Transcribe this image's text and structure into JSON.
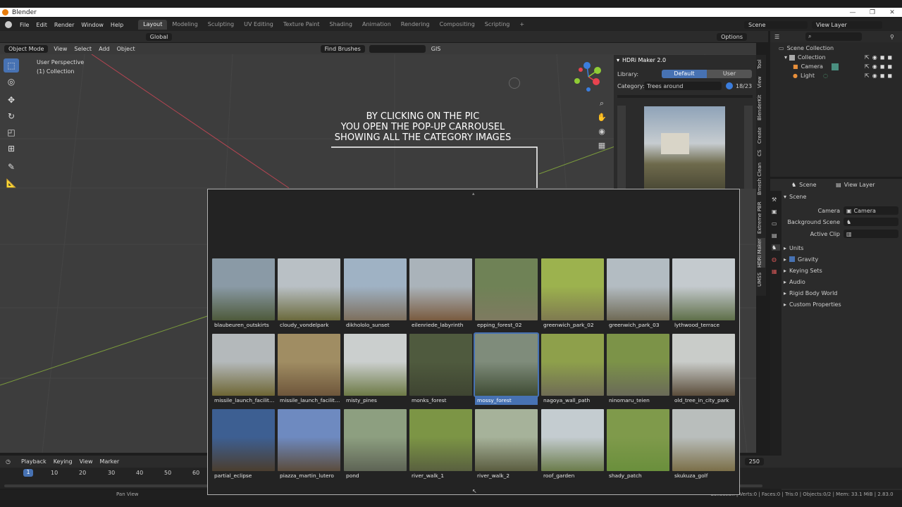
{
  "app": {
    "title": "Blender",
    "window_controls": [
      "—",
      "❐",
      "✕"
    ]
  },
  "menu": [
    "File",
    "Edit",
    "Render",
    "Window",
    "Help"
  ],
  "workspaces": {
    "tabs": [
      "Layout",
      "Modeling",
      "Sculpting",
      "UV Editing",
      "Texture Paint",
      "Shading",
      "Animation",
      "Rendering",
      "Compositing",
      "Scripting"
    ],
    "active": "Layout",
    "add": "+"
  },
  "scene_field": "Scene",
  "view_layer_field": "View Layer",
  "viewport_header": {
    "mode": "Object Mode",
    "menus": [
      "View",
      "Select",
      "Add",
      "Object"
    ],
    "orientation": "Global",
    "find_brushes": "Find Brushes",
    "gis": "GIS",
    "options": "Options"
  },
  "viewport": {
    "perspective": "User Perspective",
    "collection": "(1) Collection",
    "instruction": [
      "BY CLICKING ON THE PIC",
      "YOU OPEN THE POP-UP CARROUSEL",
      "SHOWING ALL THE CATEGORY IMAGES"
    ],
    "tool_icons": [
      "select-box-icon",
      "cursor-icon",
      "move-icon",
      "rotate-icon",
      "scale-icon",
      "transform-icon",
      "annotate-icon",
      "measure-icon"
    ],
    "nav_icons": [
      "zoom-icon",
      "hand-icon",
      "camera-view-icon",
      "grid-toggle-icon"
    ],
    "gizmo": {
      "colors": {
        "x": "#e8434f",
        "y": "#8fcc35",
        "z": "#3b7ddd"
      }
    }
  },
  "hdri_panel": {
    "title": "HDRi Maker 2.0",
    "library_label": "Library:",
    "library_options": [
      "Default",
      "User"
    ],
    "library_selected": "Default",
    "category_label": "Category:",
    "category_value": "Trees around",
    "count": "18/23"
  },
  "side_tabs": [
    "Tool",
    "View",
    "BlenderKit",
    "Create",
    "CS",
    "Bmesh Clean",
    "Extreme PBR",
    "HDRi Maker",
    "UMSS"
  ],
  "outliner": {
    "root": "Scene Collection",
    "collection": "Collection",
    "items": [
      "Camera",
      "Light"
    ]
  },
  "properties": {
    "tabs": [
      "Scene",
      "View Layer"
    ],
    "section": "Scene",
    "camera_label": "Camera",
    "camera_value": "Camera",
    "background_scene_label": "Background Scene",
    "active_clip_label": "Active Clip",
    "panels": [
      "Units",
      "Gravity",
      "Keying Sets",
      "Audio",
      "Rigid Body World",
      "Custom Properties"
    ]
  },
  "timeline": {
    "menus": [
      "Playback",
      "Keying",
      "View",
      "Marker"
    ],
    "current_frame": "1",
    "ticks": [
      "10",
      "20",
      "30",
      "40",
      "50",
      "60"
    ],
    "end_frame": "250"
  },
  "statusbar": {
    "mode": "Pan View",
    "stats": "Collection | Verts:0 | Faces:0 | Tris:0 | Objects:0/2 | Mem: 33.1 MiB | 2.83.0"
  },
  "carousel": {
    "selected": "mossy_forest",
    "images": [
      {
        "name": "blaubeuren_outskirts",
        "sky": "#8a9aa6",
        "ground": "#4e5a3b"
      },
      {
        "name": "cloudy_vondelpark",
        "sky": "#b9c0c5",
        "ground": "#6b6a3c"
      },
      {
        "name": "dikhololo_sunset",
        "sky": "#9fb2c4",
        "ground": "#7d6f5d"
      },
      {
        "name": "eilenriede_labyrinth",
        "sky": "#aab3ba",
        "ground": "#7a5b3f"
      },
      {
        "name": "epping_forest_02",
        "sky": "#6f8256",
        "ground": "#7e7a60"
      },
      {
        "name": "greenwich_park_02",
        "sky": "#9cb24e",
        "ground": "#7f7a50"
      },
      {
        "name": "greenwich_park_03",
        "sky": "#b3bcc2",
        "ground": "#6f6a55"
      },
      {
        "name": "lythwood_terrace",
        "sky": "#c4cace",
        "ground": "#5f6f49"
      },
      {
        "name": "missile_launch_facility_...",
        "sky": "#b4b9bb",
        "ground": "#6e6634"
      },
      {
        "name": "missile_launch_facility_...",
        "sky": "#a08d63",
        "ground": "#6e563b"
      },
      {
        "name": "misty_pines",
        "sky": "#cbcfce",
        "ground": "#6d7a46"
      },
      {
        "name": "monks_forest",
        "sky": "#4f5a3e",
        "ground": "#3e4431"
      },
      {
        "name": "mossy_forest",
        "sky": "#7f8c7b",
        "ground": "#3f4c34"
      },
      {
        "name": "nagoya_wall_path",
        "sky": "#8ea04b",
        "ground": "#6f6c55"
      },
      {
        "name": "ninomaru_teien",
        "sky": "#7c9348",
        "ground": "#6a6a58"
      },
      {
        "name": "old_tree_in_city_park",
        "sky": "#c9ccc9",
        "ground": "#5b4d3b"
      },
      {
        "name": "partial_eclipse",
        "sky": "#3d5f92",
        "ground": "#4b3e2f"
      },
      {
        "name": "piazza_martin_lutero",
        "sky": "#6e8ac0",
        "ground": "#5b4c3c"
      },
      {
        "name": "pond",
        "sky": "#8d9f80",
        "ground": "#5e6455"
      },
      {
        "name": "river_walk_1",
        "sky": "#7c9545",
        "ground": "#59603f"
      },
      {
        "name": "river_walk_2",
        "sky": "#a6b29a",
        "ground": "#5b5d40"
      },
      {
        "name": "roof_garden",
        "sky": "#c4ccd0",
        "ground": "#6b7c4b"
      },
      {
        "name": "shady_patch",
        "sky": "#7f9a4b",
        "ground": "#6a8f3c"
      },
      {
        "name": "skukuza_golf",
        "sky": "#b9bebc",
        "ground": "#7b6f48"
      }
    ]
  }
}
